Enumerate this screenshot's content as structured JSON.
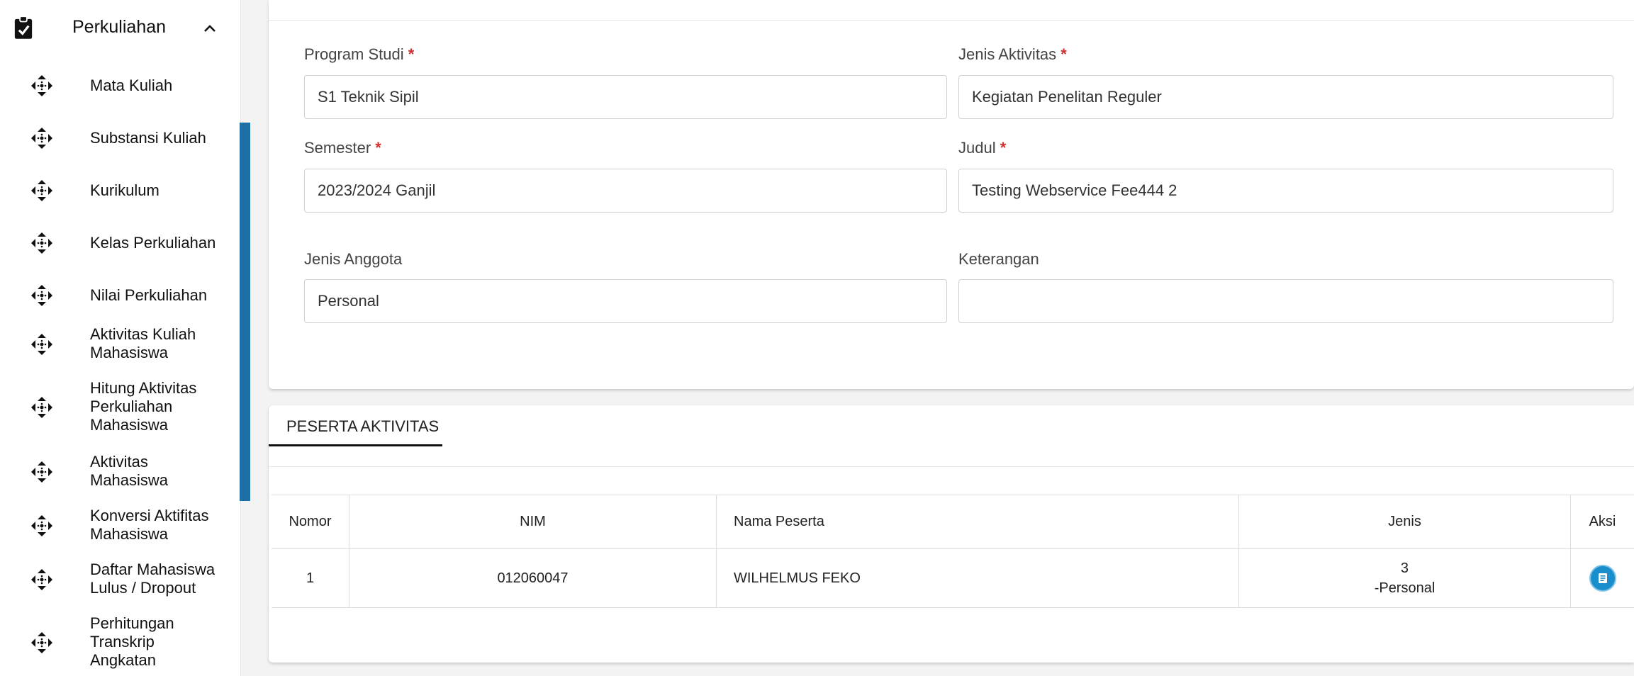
{
  "sidebar": {
    "section": {
      "title": "Perkuliahan",
      "icon": "clipboard-check-icon",
      "chevron": "chevron-up-icon"
    },
    "items": [
      {
        "label": "Mata Kuliah",
        "icon": "arrows-move-icon"
      },
      {
        "label": "Substansi Kuliah",
        "icon": "arrows-move-icon"
      },
      {
        "label": "Kurikulum",
        "icon": "arrows-move-icon"
      },
      {
        "label": "Kelas Perkuliahan",
        "icon": "arrows-move-icon"
      },
      {
        "label": "Nilai Perkuliahan",
        "icon": "arrows-move-icon"
      },
      {
        "label": "Aktivitas Kuliah Mahasiswa",
        "icon": "arrows-move-icon"
      },
      {
        "label": "Hitung Aktivitas Perkuliahan Mahasiswa",
        "icon": "arrows-move-icon"
      },
      {
        "label": "Aktivitas Mahasiswa",
        "icon": "arrows-move-icon"
      },
      {
        "label": "Konversi Aktifitas Mahasiswa",
        "icon": "arrows-move-icon"
      },
      {
        "label": "Daftar Mahasiswa Lulus / Dropout",
        "icon": "arrows-move-icon"
      },
      {
        "label": "Perhitungan Transkrip Angkatan",
        "icon": "arrows-move-icon"
      }
    ]
  },
  "form": {
    "required_mark": "*",
    "program_studi": {
      "label": "Program Studi",
      "value": "S1 Teknik Sipil"
    },
    "jenis_aktivitas": {
      "label": "Jenis Aktivitas",
      "value": "Kegiatan Penelitan Reguler"
    },
    "semester": {
      "label": "Semester",
      "value": "2023/2024 Ganjil"
    },
    "judul": {
      "label": "Judul",
      "value": "Testing Webservice Fee444 2"
    },
    "jenis_anggota": {
      "label": "Jenis Anggota",
      "value": "Personal"
    },
    "keterangan": {
      "label": "Keterangan",
      "value": ""
    }
  },
  "peserta": {
    "tab_label": "PESERTA AKTIVITAS",
    "columns": {
      "nomor": "Nomor",
      "nim": "NIM",
      "nama": "Nama Peserta",
      "jenis": "Jenis",
      "aksi": "Aksi"
    },
    "rows": [
      {
        "nomor": "1",
        "nim": "012060047",
        "nama": "WILHELMUS FEKO",
        "jenis_line1": "3",
        "jenis_line2": "-Personal",
        "action_icon": "document-list-icon"
      }
    ]
  },
  "colors": {
    "accent": "#1a8ecd",
    "scrollbar": "#1d6fa5",
    "required": "#d32f2f"
  }
}
